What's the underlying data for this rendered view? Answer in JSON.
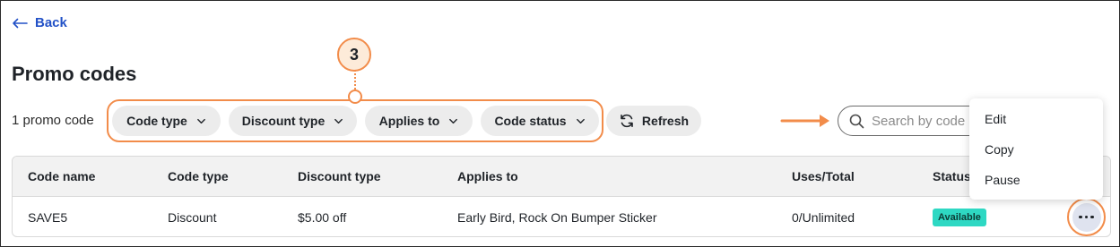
{
  "nav": {
    "back_label": "Back"
  },
  "page": {
    "title": "Promo codes",
    "count_text": "1 promo code"
  },
  "filters": [
    {
      "label": "Code type"
    },
    {
      "label": "Discount type"
    },
    {
      "label": "Applies to"
    },
    {
      "label": "Code status"
    }
  ],
  "refresh_label": "Refresh",
  "search": {
    "placeholder": "Search by code"
  },
  "annotation": {
    "step_number": "3",
    "accent_color": "#f28c4a"
  },
  "table": {
    "headers": [
      "Code name",
      "Code type",
      "Discount type",
      "Applies to",
      "Uses/Total",
      "Status"
    ],
    "rows": [
      {
        "code_name": "SAVE5",
        "code_type": "Discount",
        "discount_type": "$5.00 off",
        "applies_to": "Early Bird, Rock On Bumper Sticker",
        "uses_total": "0/Unlimited",
        "status": "Available"
      }
    ]
  },
  "menu": {
    "items": [
      "Edit",
      "Copy",
      "Pause"
    ]
  },
  "icons": {
    "back": "arrow-left-icon",
    "chevron": "chevron-down-icon",
    "refresh": "refresh-icon",
    "search": "search-icon",
    "more": "more-horizontal-icon"
  },
  "colors": {
    "link": "#2251c7",
    "status_available": "#2ed8c3"
  }
}
